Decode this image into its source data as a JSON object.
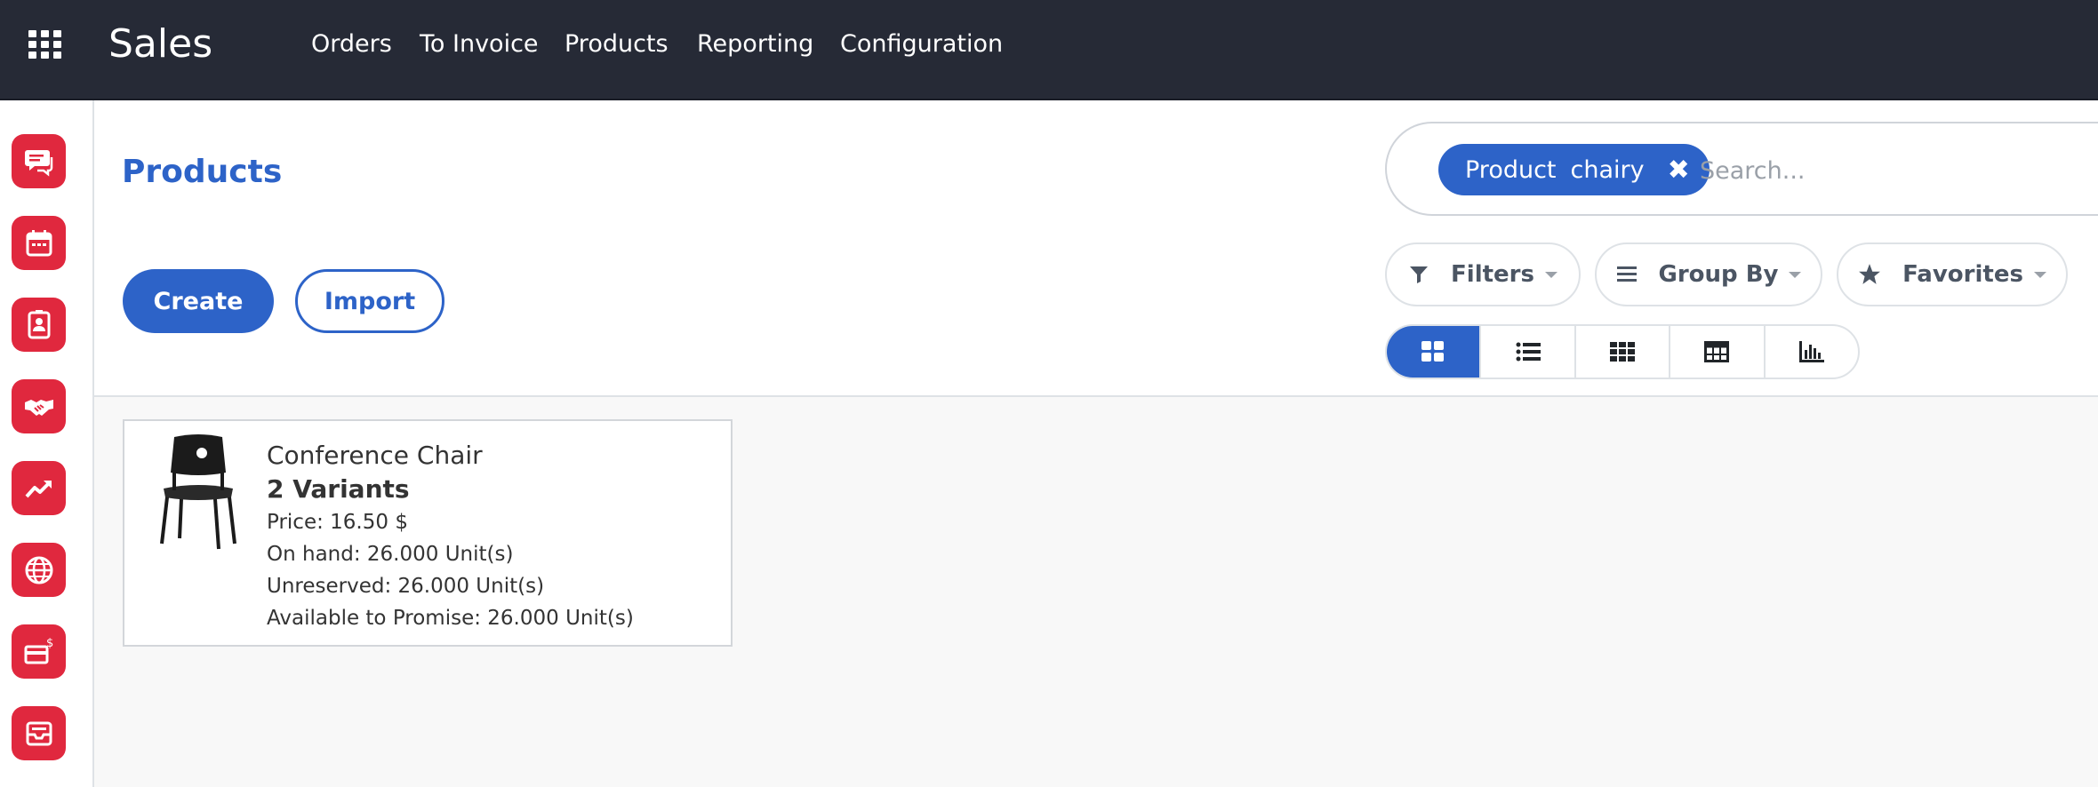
{
  "app": {
    "title": "Sales"
  },
  "menu": {
    "items": [
      {
        "label": "Orders"
      },
      {
        "label": "To Invoice"
      },
      {
        "label": "Products"
      },
      {
        "label": "Reporting"
      },
      {
        "label": "Configuration"
      }
    ]
  },
  "sidebar": {
    "items": [
      {
        "icon": "discuss-icon"
      },
      {
        "icon": "calendar-icon"
      },
      {
        "icon": "contacts-icon"
      },
      {
        "icon": "handshake-icon"
      },
      {
        "icon": "trend-up-icon"
      },
      {
        "icon": "globe-icon"
      },
      {
        "icon": "payment-card-icon"
      },
      {
        "icon": "inbox-icon"
      }
    ],
    "accent": "#e0283e"
  },
  "page": {
    "title": "Products",
    "create_label": "Create",
    "import_label": "Import"
  },
  "search": {
    "facet_label": "Product",
    "facet_value": "chairy",
    "placeholder": "Search..."
  },
  "filters": {
    "filters_label": "Filters",
    "groupby_label": "Group By",
    "favorites_label": "Favorites"
  },
  "views": [
    {
      "name": "kanban",
      "icon": "kanban-icon",
      "active": true
    },
    {
      "name": "list",
      "icon": "list-icon",
      "active": false
    },
    {
      "name": "grid",
      "icon": "grid-icon",
      "active": false
    },
    {
      "name": "pivot",
      "icon": "pivot-table-icon",
      "active": false
    },
    {
      "name": "graph",
      "icon": "bar-chart-icon",
      "active": false
    }
  ],
  "products": [
    {
      "name": "Conference Chair",
      "variants": "2 Variants",
      "price": "Price: 16.50 $",
      "on_hand": "On hand: 26.000 Unit(s)",
      "unreserved": "Unreserved: 26.000 Unit(s)",
      "available": "Available to Promise: 26.000 Unit(s)"
    }
  ],
  "colors": {
    "topbar": "#262a36",
    "primary": "#2d63c8"
  }
}
